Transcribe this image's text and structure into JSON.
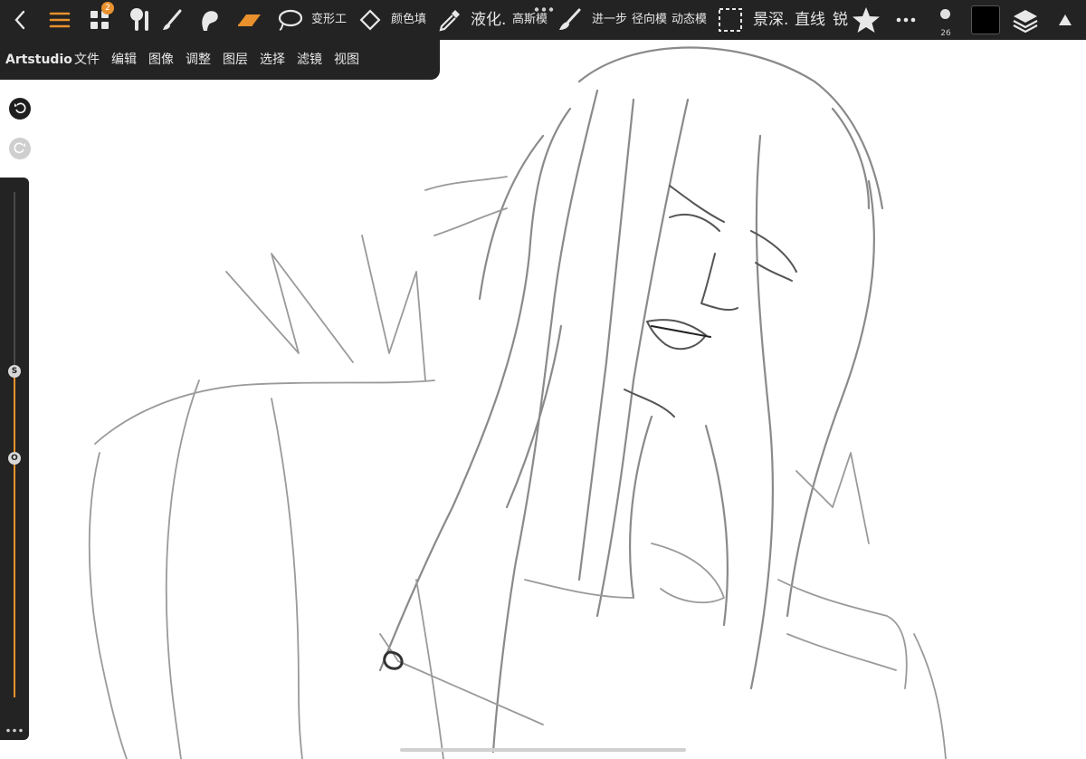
{
  "toolbar": {
    "layers_badge": "2",
    "transform_label": "变形工",
    "fill_label": "颜色填",
    "liquify_label": "液化.",
    "gaussian_label": "高斯模",
    "advance_label": "进一步",
    "radial_label": "径向模",
    "motion_label": "动态模",
    "depth_label": "景深.",
    "line_label": "直线",
    "sharpen_label": "锐",
    "brush_size": "26",
    "current_color": "#000000",
    "accent": "#e8912d"
  },
  "menu": {
    "app": "Artstudio",
    "items": [
      "文件",
      "编辑",
      "图像",
      "调整",
      "图层",
      "选择",
      "滤镜",
      "视图"
    ]
  },
  "side": {
    "size_knob": "S",
    "opacity_knob": "O"
  }
}
